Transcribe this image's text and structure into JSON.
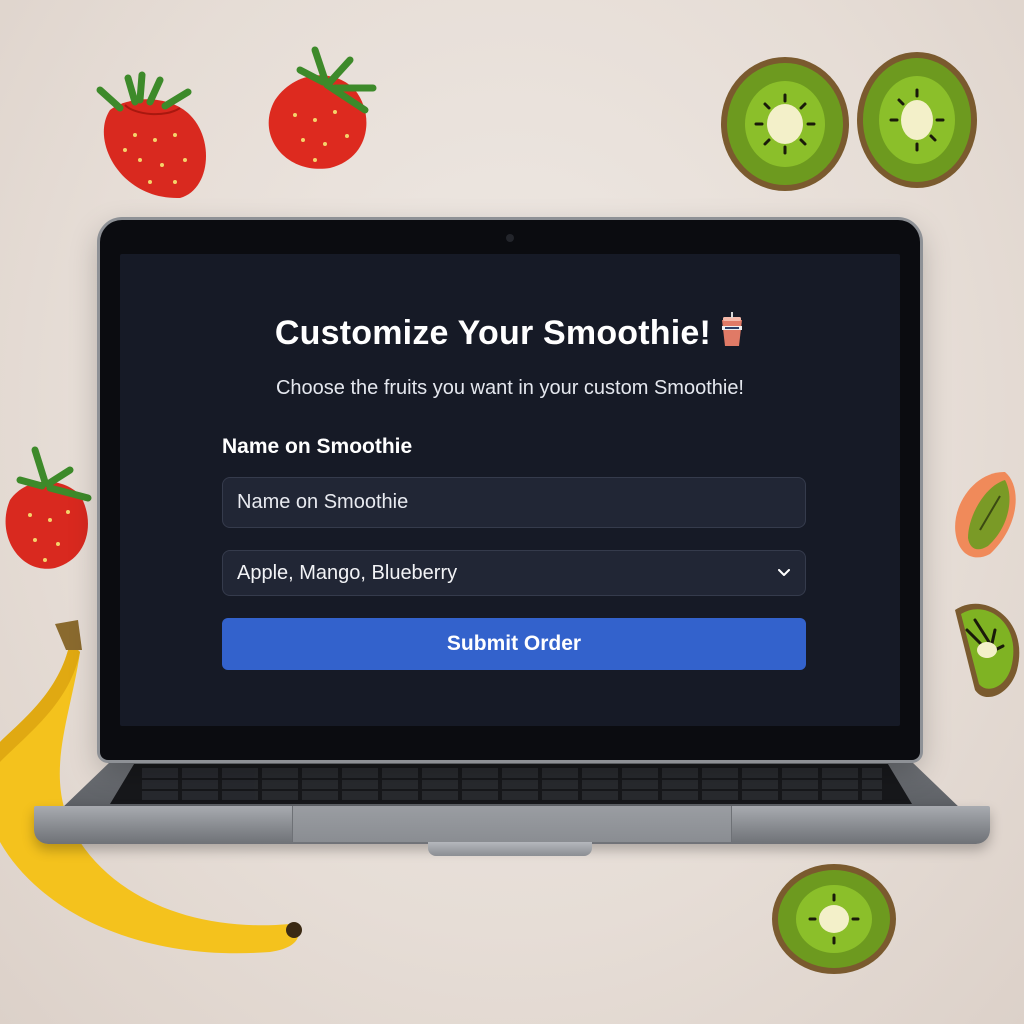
{
  "form": {
    "title": "Customize Your Smoothie!",
    "title_icon": "smoothie-cup-icon",
    "subtitle": "Choose the fruits you want in your custom Smoothie!",
    "name_label": "Name on Smoothie",
    "name_input": {
      "placeholder": "Name on Smoothie",
      "value": ""
    },
    "fruit_select": {
      "selected": "Apple, Mango, Blueberry",
      "icon": "chevron-down-icon"
    },
    "submit_label": "Submit Order"
  },
  "colors": {
    "screen_background": "#161a26",
    "field_background": "#212635",
    "submit_accent": "#3362cc",
    "page_background": "#e6ddd6"
  },
  "decor": {
    "fruit_props": [
      "strawberry",
      "strawberry",
      "strawberry",
      "kiwi-slice",
      "kiwi-slice",
      "kiwi-slice",
      "kiwi-slice",
      "peach-slice",
      "banana"
    ]
  }
}
